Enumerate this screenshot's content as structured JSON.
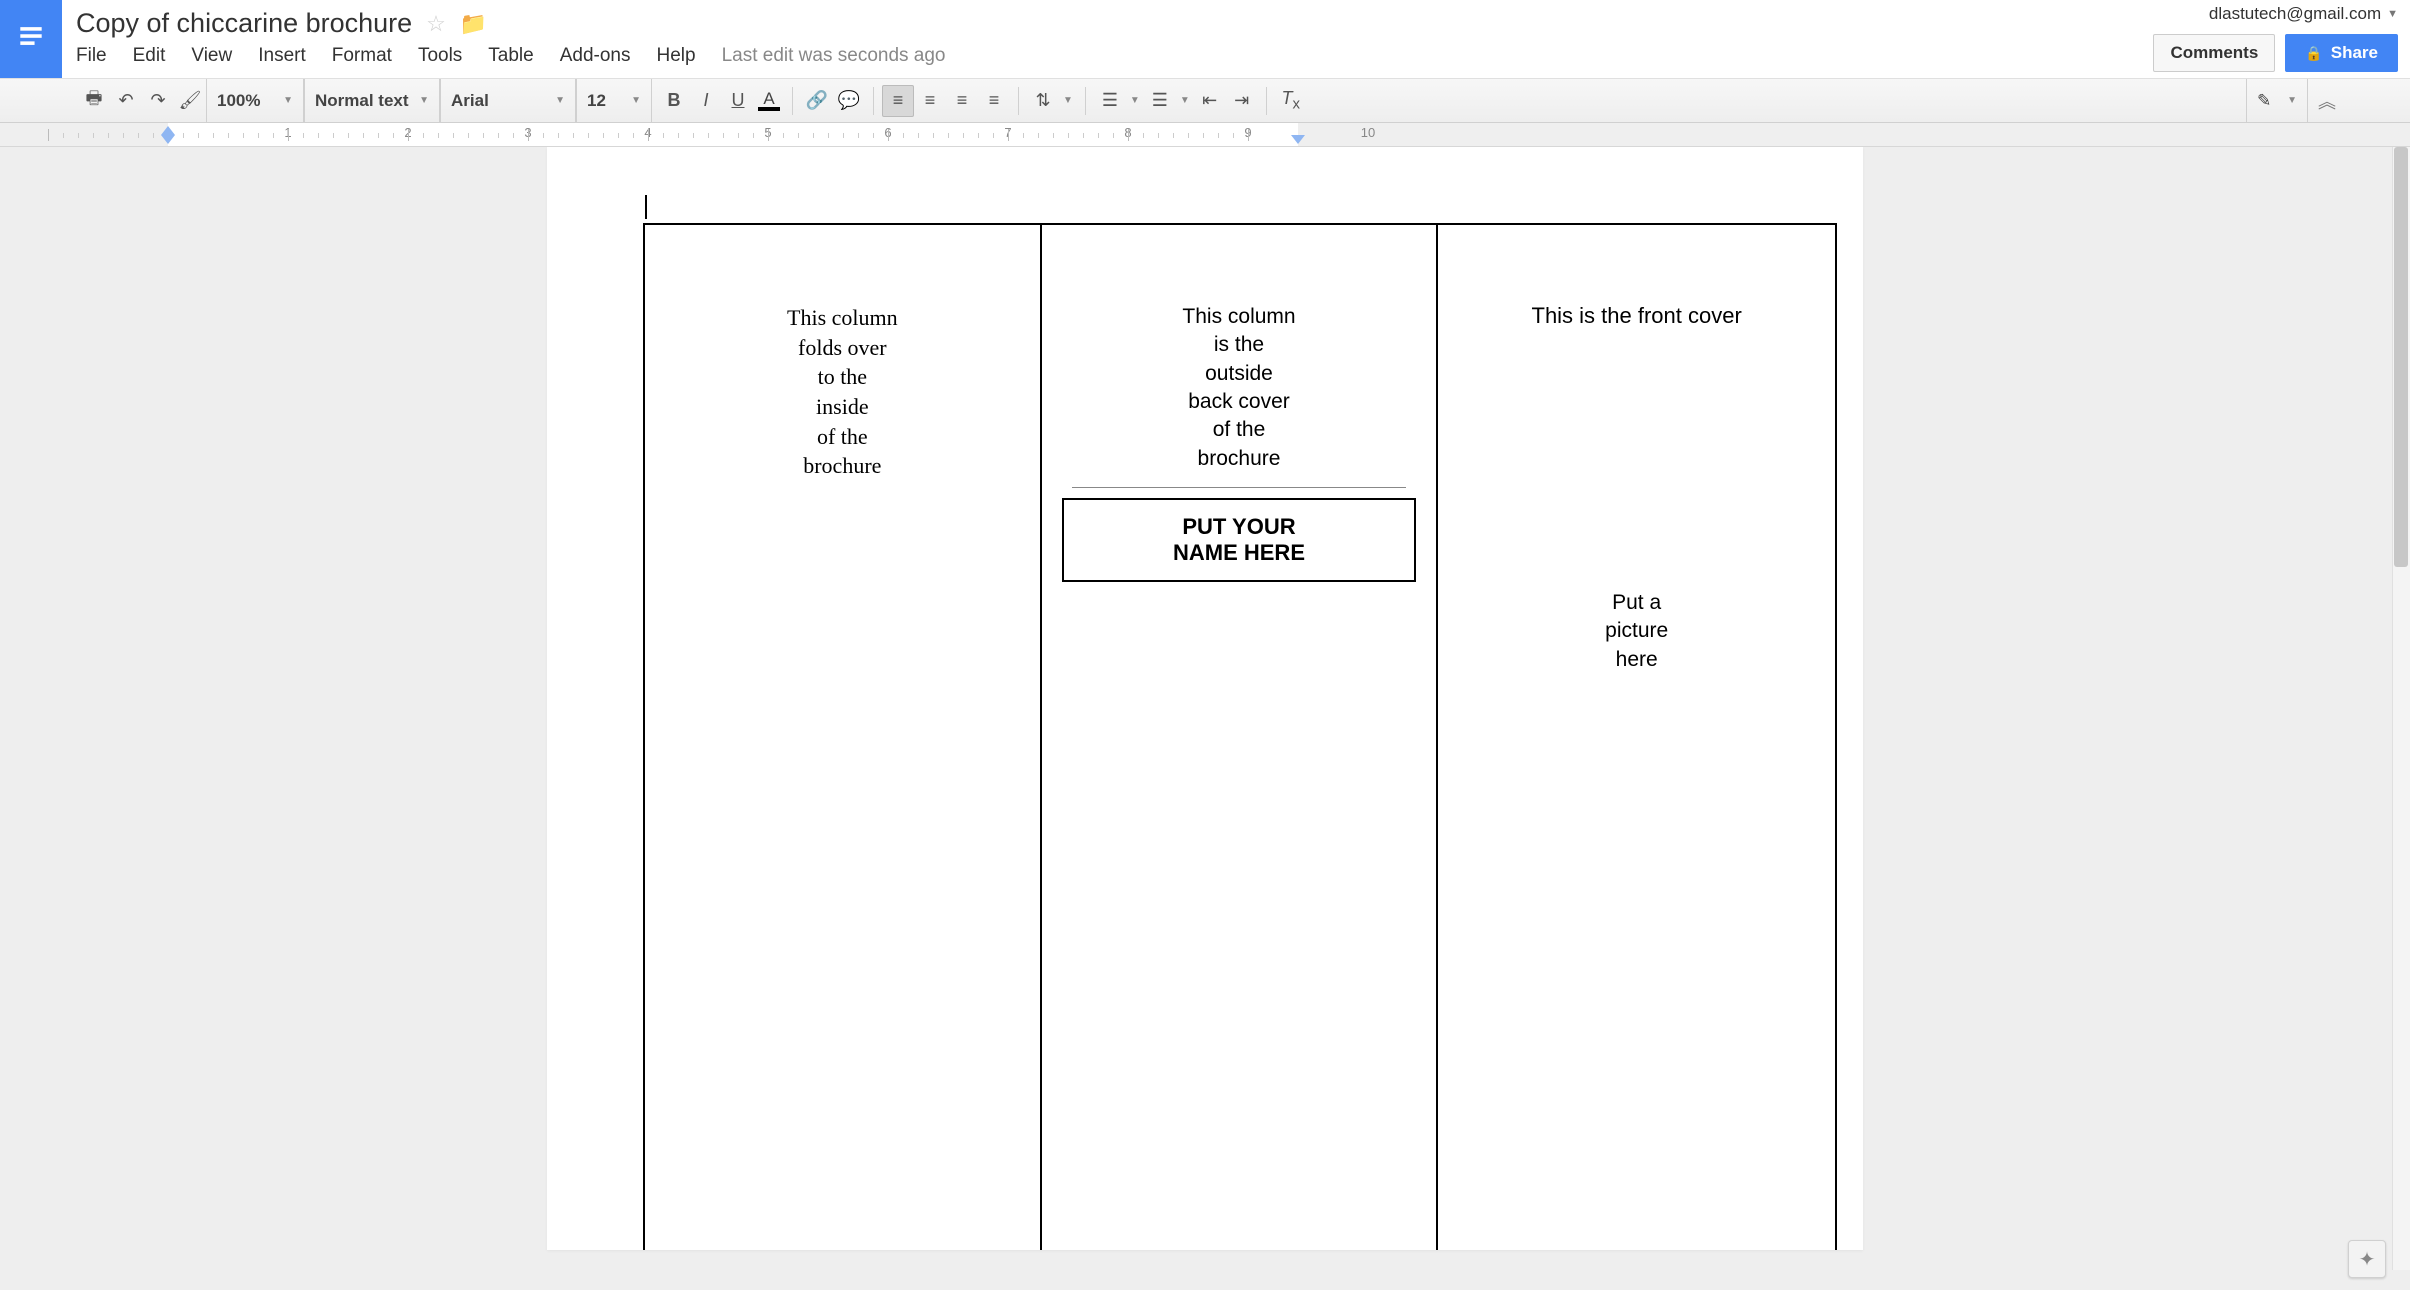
{
  "doc": {
    "title": "Copy of chiccarine brochure",
    "last_edit": "Last edit was seconds ago"
  },
  "account": {
    "email": "dlastutech@gmail.com"
  },
  "header_buttons": {
    "comments": "Comments",
    "share": "Share"
  },
  "menu": {
    "file": "File",
    "edit": "Edit",
    "view": "View",
    "insert": "Insert",
    "format": "Format",
    "tools": "Tools",
    "table": "Table",
    "addons": "Add-ons",
    "help": "Help"
  },
  "toolbar": {
    "zoom": "100%",
    "style": "Normal text",
    "font": "Arial",
    "font_size": "12"
  },
  "ruler": {
    "numbers": [
      "1",
      "2",
      "3",
      "4",
      "5",
      "6",
      "7",
      "8",
      "9",
      "10"
    ]
  },
  "content": {
    "col1_lines": [
      "This column",
      "folds over",
      "to the",
      "inside",
      "of the",
      "brochure"
    ],
    "col2_lines": [
      "This column",
      "is the",
      "outside",
      "back cover",
      "of the",
      "brochure"
    ],
    "col2_box_lines": [
      "PUT YOUR",
      "NAME HERE"
    ],
    "col3_title": "This is the front cover",
    "col3_pic_lines": [
      "Put a",
      "picture",
      "here"
    ]
  }
}
